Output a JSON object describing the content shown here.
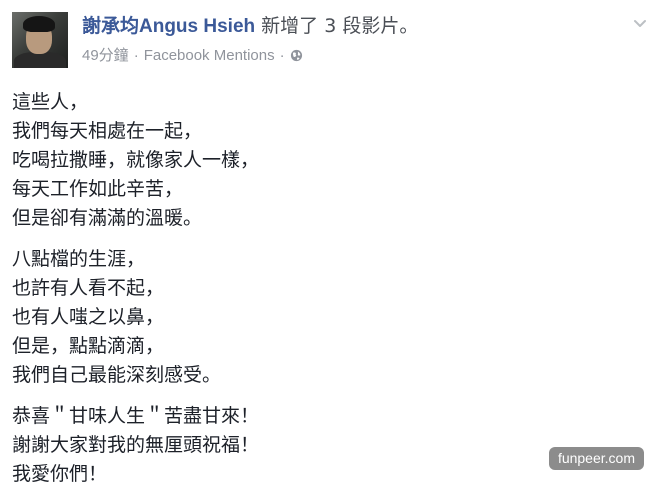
{
  "post": {
    "author": "謝承均Angus Hsieh",
    "action": " 新增了 3 段影片。",
    "time": "49分鐘",
    "separator": "·",
    "source": "Facebook Mentions",
    "audience_icon": "globe-icon",
    "menu_icon": "chevron-down-icon",
    "author_color": "#3b5998",
    "paragraphs": [
      {
        "lines": [
          "這些人，",
          "我們每天相處在一起，",
          "吃喝拉撒睡，就像家人一樣，",
          "每天工作如此辛苦，",
          "但是卻有滿滿的溫暖。"
        ]
      },
      {
        "lines": [
          "八點檔的生涯，",
          "也許有人看不起，",
          "也有人嗤之以鼻，",
          "但是，點點滴滴，",
          "我們自己最能深刻感受。"
        ]
      },
      {
        "lines": [
          "恭喜＂甘味人生＂苦盡甘來！",
          "謝謝大家對我的無厘頭祝福！",
          "我愛你們！"
        ]
      }
    ]
  },
  "watermark": "funpeer.com"
}
